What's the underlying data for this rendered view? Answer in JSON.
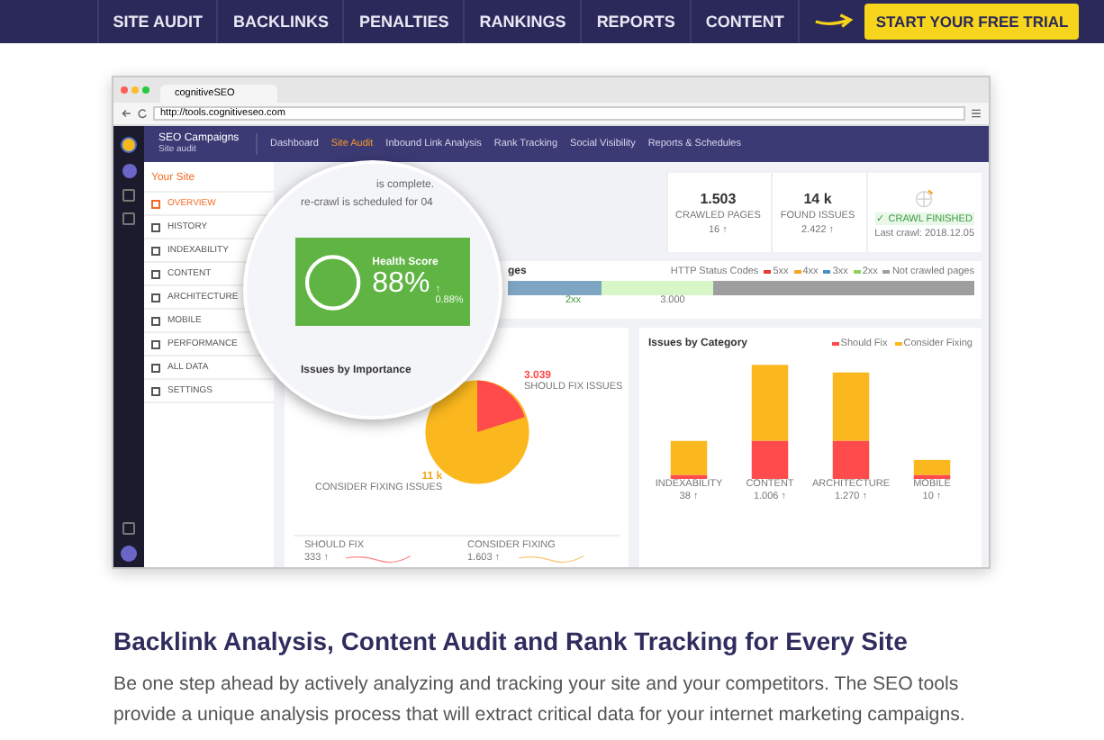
{
  "nav": {
    "items": [
      "SITE AUDIT",
      "BACKLINKS",
      "PENALTIES",
      "RANKINGS",
      "REPORTS",
      "CONTENT"
    ],
    "cta": "START YOUR FREE TRIAL"
  },
  "browser": {
    "tab_title": "cognitiveSEO",
    "url": "http://tools.cognitiveseo.com"
  },
  "app": {
    "campaign": "SEO Campaigns",
    "campaign_sub": "Site audit",
    "menu": [
      {
        "label": "Dashboard",
        "selected": false
      },
      {
        "label": "Site Audit",
        "selected": true
      },
      {
        "label": "Inbound Link Analysis",
        "selected": false
      },
      {
        "label": "Rank Tracking",
        "selected": false
      },
      {
        "label": "Social Visibility",
        "selected": false
      },
      {
        "label": "Reports & Schedules",
        "selected": false
      }
    ],
    "sidebar": {
      "title": "Your Site",
      "items": [
        {
          "label": "OVERVIEW",
          "selected": true
        },
        {
          "label": "HISTORY",
          "selected": false
        },
        {
          "label": "INDEXABILITY",
          "selected": false
        },
        {
          "label": "CONTENT",
          "selected": false
        },
        {
          "label": "ARCHITECTURE",
          "selected": false
        },
        {
          "label": "MOBILE",
          "selected": false
        },
        {
          "label": "PERFORMANCE",
          "selected": false
        },
        {
          "label": "ALL DATA",
          "selected": false
        },
        {
          "label": "SETTINGS",
          "selected": false
        }
      ]
    },
    "crawl_text": [
      "is complete.",
      "re-crawl is scheduled for 04"
    ],
    "stats": [
      {
        "value": "1.503",
        "label": "CRAWLED PAGES",
        "delta": "16 ↑"
      },
      {
        "value": "14 k",
        "label": "FOUND ISSUES",
        "delta": "2.422 ↑"
      }
    ],
    "crawl": {
      "status": "✓ CRAWL FINISHED",
      "last": "Last crawl: 2018.12.05"
    },
    "health": {
      "title": "Health Score",
      "value": "88%",
      "change": "↑ 0.88%"
    },
    "pages": {
      "title": "ges",
      "legend_title": "HTTP Status Codes",
      "legend": [
        {
          "label": "5xx",
          "color": "#e53935"
        },
        {
          "label": "4xx",
          "color": "#f5a623"
        },
        {
          "label": "3xx",
          "color": "#4a90c2"
        },
        {
          "label": "2xx",
          "color": "#8bd35b"
        },
        {
          "label": "Not crawled pages",
          "color": "#9e9e9e"
        }
      ],
      "marks": [
        "2xx",
        "3.000"
      ]
    },
    "importance": {
      "title": "Issues by Importance",
      "should": {
        "value": "3.039",
        "label": "SHOULD FIX ISSUES"
      },
      "consider": {
        "value": "11 k",
        "label": "CONSIDER FIXING ISSUES"
      },
      "summary": [
        {
          "label": "SHOULD FIX",
          "value": "333 ↑"
        },
        {
          "label": "CONSIDER FIXING",
          "value": "1.603 ↑"
        }
      ]
    },
    "category": {
      "title": "Issues by Category",
      "legend": [
        {
          "label": "Should Fix",
          "color": "#ff4b4b"
        },
        {
          "label": "Consider Fixing",
          "color": "#fbb81e"
        }
      ],
      "bars": [
        {
          "label": "INDEXABILITY",
          "value": "38 ↑"
        },
        {
          "label": "CONTENT",
          "value": "1.006 ↑"
        },
        {
          "label": "ARCHITECTURE",
          "value": "1.270 ↑"
        },
        {
          "label": "MOBILE",
          "value": "10 ↑"
        }
      ]
    }
  },
  "heading": "Backlink Analysis, Content Audit and Rank Tracking for Every Site",
  "paragraph": "Be one step ahead by actively analyzing and tracking your site and your competitors. The SEO tools provide a unique analysis process that will extract critical data for your internet marketing campaigns."
}
